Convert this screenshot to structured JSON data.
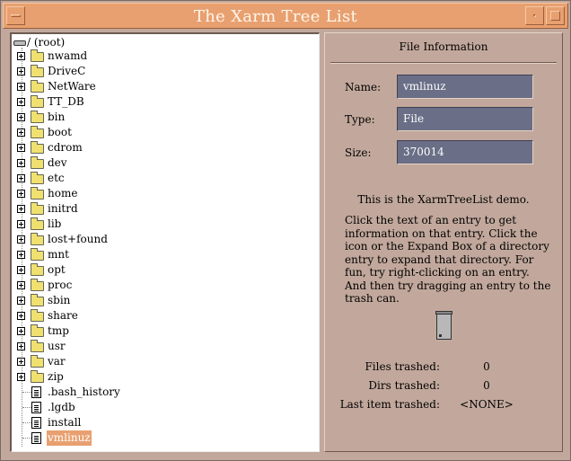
{
  "window": {
    "title": "The Xarm Tree List"
  },
  "tree": {
    "root_label": "/ (root)",
    "directories": [
      "nwamd",
      "DriveC",
      "NetWare",
      "TT_DB",
      "bin",
      "boot",
      "cdrom",
      "dev",
      "etc",
      "home",
      "initrd",
      "lib",
      "lost+found",
      "mnt",
      "opt",
      "proc",
      "sbin",
      "share",
      "tmp",
      "usr",
      "var",
      "zip"
    ],
    "files": [
      ".bash_history",
      ".lgdb",
      "install",
      "vmlinuz"
    ],
    "selected": "vmlinuz"
  },
  "info": {
    "heading": "File Information",
    "name_label": "Name:",
    "name_value": "vmlinuz",
    "type_label": "Type:",
    "type_value": "File",
    "size_label": "Size:",
    "size_value": "370014",
    "demo_line": "This is the XarmTreeList demo.",
    "help_text": "Click the text of an entry to get information on that entry. Click the icon or the Expand Box of a directory entry to expand that directory. For fun, try right-clicking on an entry. And then try dragging an entry to the trash can.",
    "files_trashed_label": "Files trashed:",
    "files_trashed_value": "0",
    "dirs_trashed_label": "Dirs trashed:",
    "dirs_trashed_value": "0",
    "last_trashed_label": "Last item trashed:",
    "last_trashed_value": "<NONE>"
  }
}
